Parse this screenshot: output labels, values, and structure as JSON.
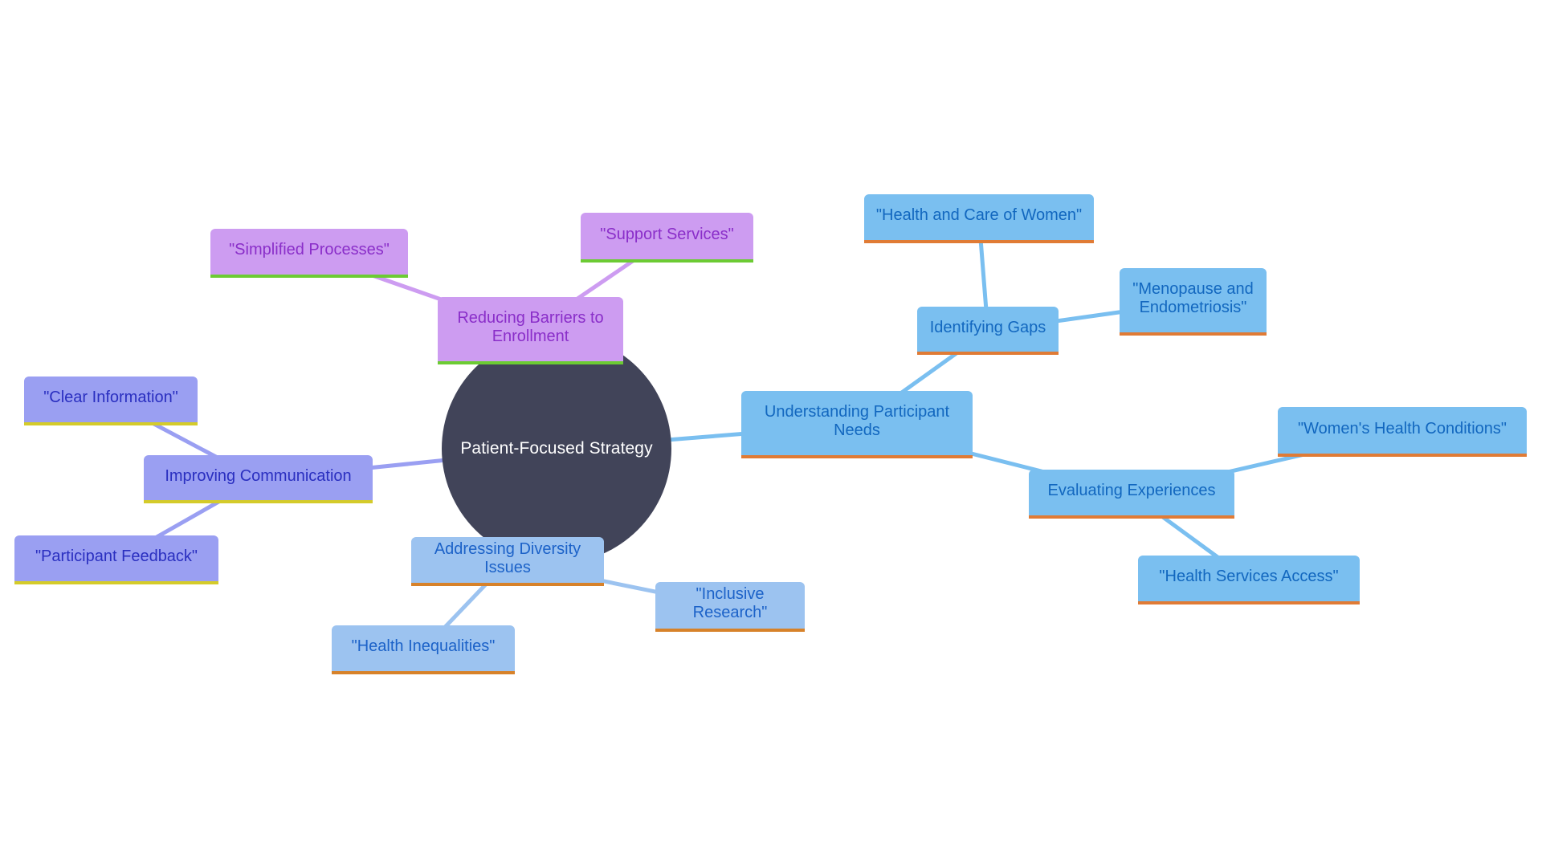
{
  "diagram": {
    "type": "mindmap",
    "root": {
      "id": "root",
      "label": "Patient-Focused Strategy",
      "color": "#414459",
      "text_color": "#ffffff"
    },
    "branches": [
      {
        "id": "reducing",
        "label": "Reducing Barriers to Enrollment",
        "theme": "purple",
        "children": [
          {
            "id": "simplified",
            "label": "\"Simplified Processes\""
          },
          {
            "id": "support",
            "label": "\"Support Services\""
          }
        ]
      },
      {
        "id": "improving",
        "label": "Improving Communication",
        "theme": "indigo",
        "children": [
          {
            "id": "clear",
            "label": "\"Clear Information\""
          },
          {
            "id": "feedback",
            "label": "\"Participant Feedback\""
          }
        ]
      },
      {
        "id": "diversity",
        "label": "Addressing Diversity Issues",
        "theme": "sky",
        "children": [
          {
            "id": "inequalities",
            "label": "\"Health Inequalities\""
          },
          {
            "id": "inclusive",
            "label": "\"Inclusive Research\""
          }
        ]
      },
      {
        "id": "understanding",
        "label": "Understanding Participant Needs",
        "theme": "blue",
        "children": [
          {
            "id": "gaps",
            "label": "Identifying Gaps",
            "children": [
              {
                "id": "carewomen",
                "label": "\"Health and Care of Women\""
              },
              {
                "id": "menopause",
                "label": "\"Menopause and Endometriosis\""
              }
            ]
          },
          {
            "id": "evaluating",
            "label": "Evaluating Experiences",
            "children": [
              {
                "id": "conditions",
                "label": "\"Women's Health Conditions\""
              },
              {
                "id": "access",
                "label": "\"Health Services Access\""
              }
            ]
          }
        ]
      }
    ],
    "themes": {
      "purple": {
        "fill": "#cd9cf1",
        "text": "#8a2ec9",
        "underline": "#6ccb33",
        "edge": "#cd9cf1"
      },
      "indigo": {
        "fill": "#9a9ff2",
        "text": "#2a2fc0",
        "underline": "#d4cb2a",
        "edge": "#9a9ff2"
      },
      "sky": {
        "fill": "#9cc3f0",
        "text": "#1c62c8",
        "underline": "#d7822a",
        "edge": "#9cc3f0"
      },
      "blue": {
        "fill": "#7abff0",
        "text": "#1267bf",
        "underline": "#e07b35",
        "edge": "#7abff0"
      }
    }
  }
}
